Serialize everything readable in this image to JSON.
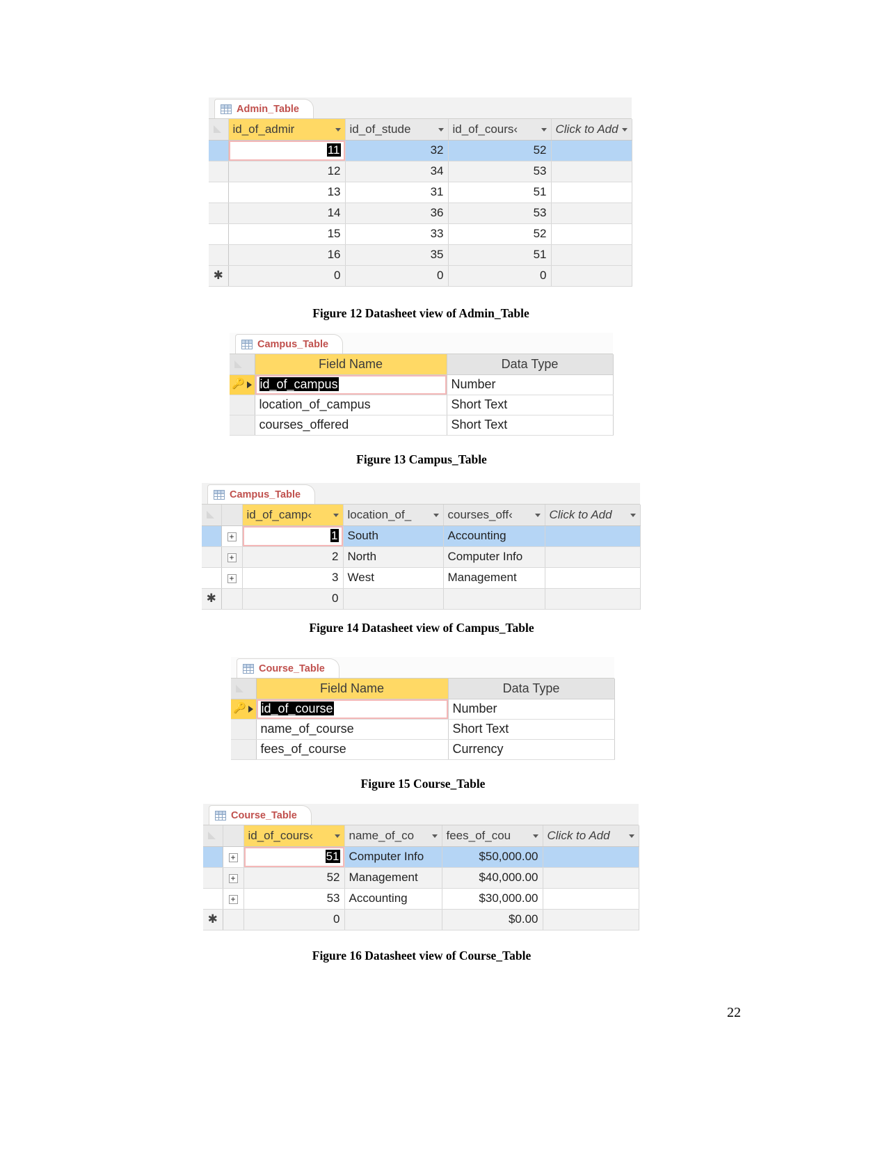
{
  "page": {
    "number": "22"
  },
  "figures": [
    {
      "id": "admin-datasheet",
      "caption": "Figure 12 Datasheet view of Admin_Table",
      "tab_label": "Admin_Table",
      "view": "datasheet",
      "columns": [
        "id_of_admir",
        "id_of_stude",
        "id_of_cours‹",
        "Click to Add"
      ],
      "rows": [
        {
          "values": [
            "11",
            "32",
            "52"
          ],
          "state": "selected",
          "editing_cell": 0,
          "selected_text": "11"
        },
        {
          "values": [
            "12",
            "34",
            "53"
          ],
          "state": "alt"
        },
        {
          "values": [
            "13",
            "31",
            "51"
          ],
          "state": "plain"
        },
        {
          "values": [
            "14",
            "36",
            "53"
          ],
          "state": "alt"
        },
        {
          "values": [
            "15",
            "33",
            "52"
          ],
          "state": "plain"
        },
        {
          "values": [
            "16",
            "35",
            "51"
          ],
          "state": "alt"
        },
        {
          "values": [
            "0",
            "0",
            "0"
          ],
          "state": "new"
        }
      ],
      "new_record_marker": "✱"
    },
    {
      "id": "campus-design",
      "caption": "Figure 13 Campus_Table",
      "tab_label": "Campus_Table",
      "view": "design",
      "headers": {
        "field_name": "Field Name",
        "data_type": "Data Type"
      },
      "rows": [
        {
          "field": "id_of_campus",
          "type": "Number",
          "primary_key": true,
          "editing": true,
          "selected_text": "id_of_campus"
        },
        {
          "field": "location_of_campus",
          "type": "Short Text",
          "primary_key": false
        },
        {
          "field": "courses_offered",
          "type": "Short Text",
          "primary_key": false
        }
      ]
    },
    {
      "id": "campus-datasheet",
      "caption": "Figure 14 Datasheet view of Campus_Table",
      "tab_label": "Campus_Table",
      "view": "datasheet",
      "columns": [
        "id_of_camp‹",
        "location_of_",
        "courses_off‹",
        "Click to Add"
      ],
      "rows": [
        {
          "values": [
            "1",
            "South",
            "Accounting"
          ],
          "state": "selected",
          "editing_cell": 0,
          "selected_text": "1",
          "expandable": true
        },
        {
          "values": [
            "2",
            "North",
            "Computer Info"
          ],
          "state": "alt",
          "expandable": true
        },
        {
          "values": [
            "3",
            "West",
            "Management"
          ],
          "state": "plain",
          "expandable": true
        },
        {
          "values": [
            "0",
            "",
            ""
          ],
          "state": "new"
        }
      ],
      "new_record_marker": "✱"
    },
    {
      "id": "course-design",
      "caption": "Figure 15 Course_Table",
      "tab_label": "Course_Table",
      "view": "design",
      "headers": {
        "field_name": "Field Name",
        "data_type": "Data Type"
      },
      "rows": [
        {
          "field": "id_of_course",
          "type": "Number",
          "primary_key": true,
          "editing": true,
          "selected_text": "id_of_course"
        },
        {
          "field": "name_of_course",
          "type": "Short Text",
          "primary_key": false
        },
        {
          "field": "fees_of_course",
          "type": "Currency",
          "primary_key": false
        }
      ]
    },
    {
      "id": "course-datasheet",
      "caption": "Figure 16 Datasheet view of Course_Table",
      "tab_label": "Course_Table",
      "view": "datasheet",
      "columns": [
        "id_of_cours‹",
        "name_of_co",
        "fees_of_cou",
        "Click to Add"
      ],
      "rows": [
        {
          "values": [
            "51",
            "Computer Info",
            "$50,000.00"
          ],
          "state": "selected",
          "editing_cell": 0,
          "selected_text": "51",
          "expandable": true
        },
        {
          "values": [
            "52",
            "Management",
            "$40,000.00"
          ],
          "state": "alt",
          "expandable": true
        },
        {
          "values": [
            "53",
            "Accounting",
            "$30,000.00"
          ],
          "state": "plain",
          "expandable": true
        },
        {
          "values": [
            "0",
            "",
            "$0.00"
          ],
          "state": "new"
        }
      ],
      "new_record_marker": "✱"
    }
  ]
}
